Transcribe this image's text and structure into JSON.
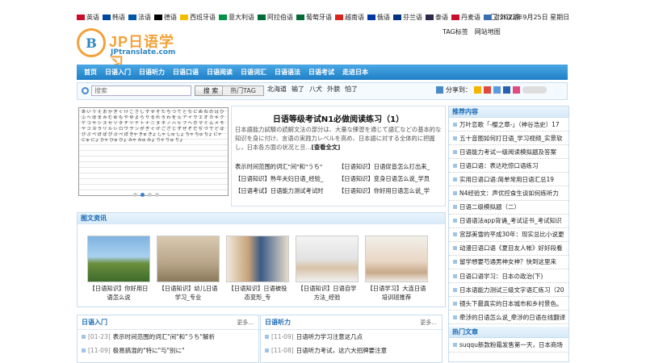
{
  "langs": [
    {
      "label": "英语",
      "color": "#c8102e"
    },
    {
      "label": "韩语",
      "color": "#0047a0"
    },
    {
      "label": "法语",
      "color": "#0055a4"
    },
    {
      "label": "德语",
      "color": "#000000"
    },
    {
      "label": "西班牙语",
      "color": "#f1bf00"
    },
    {
      "label": "意大利语",
      "color": "#009246"
    },
    {
      "label": "阿拉伯语",
      "color": "#006c35"
    },
    {
      "label": "葡萄牙语",
      "color": "#046a38"
    },
    {
      "label": "越南语",
      "color": "#da251d"
    },
    {
      "label": "俄语",
      "color": "#0039a6"
    },
    {
      "label": "芬兰语",
      "color": "#003580"
    },
    {
      "label": "泰语",
      "color": "#2d2a4a"
    },
    {
      "label": "丹麦语",
      "color": "#c8102e"
    },
    {
      "label": "对外汉语",
      "color": "#3a6fb0"
    }
  ],
  "date": "2022年9月25日 星期日",
  "toplinks": [
    "TAG标签",
    "网站地图"
  ],
  "logo": {
    "badge": "B",
    "brand": "JP日语学习",
    "sub": "JPtranslate.com"
  },
  "nav": [
    "首页",
    "日语入门",
    "日语听力",
    "日语口语",
    "日语阅读",
    "日语词汇",
    "日语语法",
    "日语考试",
    "走进日本"
  ],
  "search": {
    "placeholder": "搜索",
    "button": "搜 索",
    "hottag": "热门TAG",
    "hotwords": [
      "北海道",
      "输了",
      "八犬",
      "外貌",
      "怕了"
    ]
  },
  "share_label": "分享到：",
  "feature": {
    "title": "日语等级考试N1必做阅读练习（1）",
    "desc": "日本語能力試験の読解文法の部分は、大量な練習を通じて語汇などの基本的な知识を身に付け、言语の実践力レベルを高め、日本語に対する全体的に把握し，日本各方面の状况と旦...",
    "more": "[查看全文]",
    "links": [
      "表示时间范围的词汇\"间\"和\"うち\"",
      "【日语知识】日语促音怎么打出来_",
      "【日语知识】熟年夫妇日语_经验_",
      "【日语知识】变身日语怎么说_学员",
      "【日语考试】日语能力测试考试时",
      "【日语知识】你好用日语怎么说_学"
    ]
  },
  "slider": {
    "kana": "あ い う え お か き く け こ さ し す せ そ た ち つ て と な に ぬ ね の は ひ ふ へ ほ ま み む め も や ゆ よ ら り る れ ろ わ を ん ア イ ウ エ オ カ キ ク ケ コ サ シ ス セ ソ タ チ ツ テ ト ナ ニ ヌ ネ ノ ハ ヒ フ ヘ ホ マ ミ ム メ モ ヤ ユ ヨ ラ リ ル レ ロ ワ ヲ ン が ぎ ぐ げ ご ざ じ ず ぜ ぞ だ ぢ づ で ど ば び ぶ べ ぼ ぱ ぴ ぷ ぺ ぽ きゃ きゅ きょ しゃ しゅ しょ ちゃ ちゅ ちょ にゃ にゅ にょ ひゃ ひゅ ひょ みゃ みゅ みょ りゃ りゅ りょ",
    "dots": 4,
    "active": 1
  },
  "pics": {
    "title": "图文资讯",
    "items": [
      {
        "caption": "【日语知识】你好用日语怎么说"
      },
      {
        "caption": "【日语知识】幼儿日语学习_专业"
      },
      {
        "caption": "【日语知识】日语被役态变形_专"
      },
      {
        "caption": "【日语知识】日语自学方法_经验"
      },
      {
        "caption": "【日语学习】大连日语培训班推荐"
      }
    ]
  },
  "side1": {
    "title": "推荐内容",
    "items": [
      "万叶恋歌「-樱之章-」（神谷浩史）17",
      "五十音图如何打日语_学习视频_实景软",
      "日语能力考试一级阅读模拟题及答案",
      "日语口语：表达吃惊口语练习",
      "实用日语口语:简单常用日语汇总19",
      "N4经验文：声优控食生谈如何练听力",
      "日语二级模拟题（二）",
      "日语语法app背诵_考试证书_考试知识",
      "宫部美雪的平成30年：现实总比小说更",
      "动漫日语口语《夏目友人帐》好好段看",
      "留学想要芍通男神女神？快到这里来",
      "日语口语学习：日本の政治(下)",
      "日本语能力测试三级文字语汇练习（20",
      "镜头下最真实的日本城市和乡村景色。",
      "牵涉的日语怎么说_牵涉的日语在线翻译"
    ]
  },
  "side2": {
    "title": "热门文章",
    "items": [
      "suqqu新款粉霜发售第一天，日本商场"
    ]
  },
  "box1": {
    "title": "日语入门",
    "more": "更多...",
    "items": [
      {
        "date": "[01-23]",
        "text": "表示时间范围的词汇\"间\"和\"うち\"解析"
      },
      {
        "date": "[11-09]",
        "text": "极易搞混的\"特に\"与\"别に\""
      }
    ]
  },
  "box2": {
    "title": "日语听力",
    "more": "更多...",
    "items": [
      {
        "date": "[11-09]",
        "text": "日语听力学习注意这几点"
      },
      {
        "date": "[11-08]",
        "text": "日语听力考试，这六大招牌要注意"
      }
    ]
  }
}
